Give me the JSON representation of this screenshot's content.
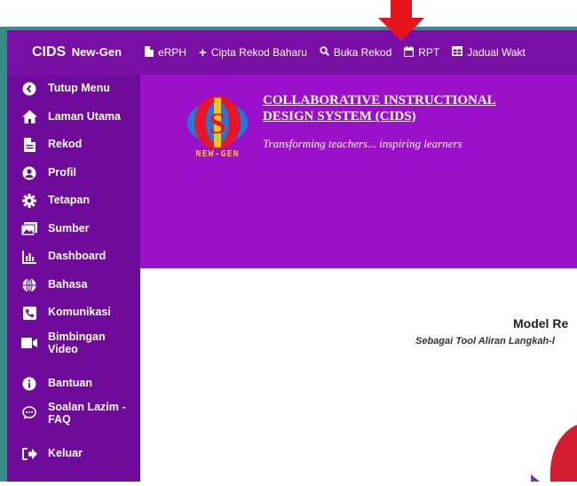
{
  "brand": {
    "name": "CIDS",
    "suffix": "New-Gen"
  },
  "topnav": [
    {
      "label": "eRPH",
      "icon": "document-icon"
    },
    {
      "label": "Cipta Rekod Baharu",
      "icon": "plus-icon"
    },
    {
      "label": "Buka Rekod",
      "icon": "search-icon"
    },
    {
      "label": "RPT",
      "icon": "calendar-icon"
    },
    {
      "label": "Jadual Wakt",
      "icon": "table-icon"
    }
  ],
  "sidebar": {
    "items": [
      {
        "label": "Tutup Menu",
        "icon": "chevron-left-circle-icon"
      },
      {
        "label": "Laman Utama",
        "icon": "home-icon"
      },
      {
        "label": "Rekod",
        "icon": "file-icon"
      },
      {
        "label": "Profil",
        "icon": "user-icon"
      },
      {
        "label": "Tetapan",
        "icon": "gear-icon"
      },
      {
        "label": "Sumber",
        "icon": "image-icon"
      },
      {
        "label": "Dashboard",
        "icon": "chart-icon"
      },
      {
        "label": "Bahasa",
        "icon": "globe-icon"
      },
      {
        "label": "Komunikasi",
        "icon": "phone-icon"
      },
      {
        "label": "Bimbingan Video",
        "icon": "video-icon"
      },
      {
        "label": "Bantuan",
        "icon": "info-icon"
      },
      {
        "label": "Soalan Lazim - FAQ",
        "icon": "chat-icon"
      },
      {
        "label": "Keluar",
        "icon": "logout-icon"
      }
    ]
  },
  "hero": {
    "title_line1": "COLLABORATIVE INSTRUCTIONAL",
    "title_line2": "DESIGN SYSTEM (CIDS)",
    "tagline": "Transforming teachers... inspiring learners",
    "logo_text": "NEW-GEN"
  },
  "content": {
    "title": "Model Re",
    "subtitle": "Sebagai Tool Aliran Langkah-l"
  },
  "colors": {
    "topbar": "#7a0fa6",
    "sidebar": "#6e0b9a",
    "hero": "#9b10c9",
    "frame": "#3a8a86",
    "annotation": "#e8141b"
  }
}
